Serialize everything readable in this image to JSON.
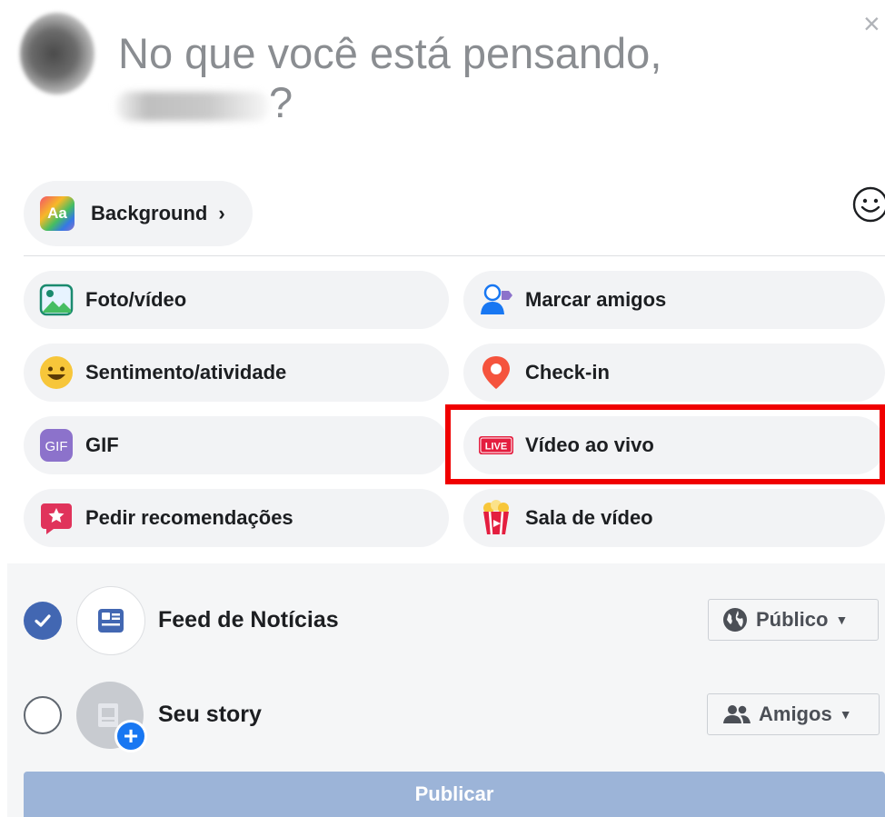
{
  "composer": {
    "placeholder_line1": "No que você está pensando,",
    "placeholder_q": "?",
    "close_glyph": "×",
    "background_label": "Background",
    "background_chevron": "›",
    "aa_badge": "Aa"
  },
  "options": {
    "photo_video": "Foto/vídeo",
    "tag_friends": "Marcar amigos",
    "feeling": "Sentimento/atividade",
    "checkin": "Check-in",
    "gif": "GIF",
    "gif_badge": "GIF",
    "live_video": "Vídeo ao vivo",
    "live_badge": "LIVE",
    "recommendations": "Pedir recomendações",
    "watch_party": "Sala de vídeo"
  },
  "destinations": {
    "news_feed": {
      "label": "Feed de Notícias",
      "checked": true,
      "audience": "Público"
    },
    "story": {
      "label": "Seu story",
      "checked": false,
      "audience": "Amigos"
    }
  },
  "publish_label": "Publicar",
  "colors": {
    "accent": "#4267b2",
    "publish_disabled": "#9cb4d8",
    "highlight": "#f00000",
    "live_red": "#e41e3f"
  }
}
